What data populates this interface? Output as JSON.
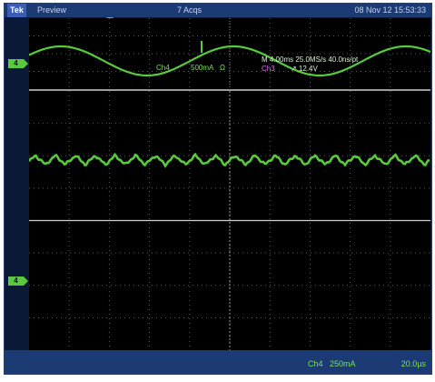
{
  "header": {
    "brand": "Tek",
    "mode": "Preview",
    "acquisitions": "7 Acqs",
    "datetime": "08 Nov 12 15:53:33"
  },
  "channel_marker": {
    "label": "4"
  },
  "overlay": {
    "channel": "Ch4",
    "scale": "500mA",
    "impedance": "Ω",
    "timebase_readout": "M 4.00ms 25.0MS/s 40.0ns/pt",
    "trigger_channel": "Ch3",
    "trigger_level": "↗ 12.4V"
  },
  "footer": {
    "channel": "Ch4",
    "scale": "250mA",
    "timebase": "20.0µs"
  },
  "colors": {
    "trace": "#59c93e",
    "grid": "#8a8a8a",
    "background": "#000000",
    "bar": "#1c3a74"
  }
}
